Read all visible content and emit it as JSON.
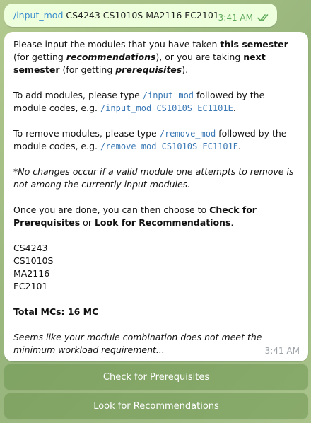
{
  "outgoing": {
    "command": "/input_mod",
    "modules_text": "CS4243 CS1010S MA2116 EC2101",
    "time": "3:41 AM",
    "status_icon": "double-check-icon"
  },
  "incoming": {
    "p1": {
      "a": "Please input the modules that you have taken ",
      "b": "this semester",
      "c": " (for getting ",
      "d": "recommendations",
      "e": "), or you are taking ",
      "f": "next semester",
      "g": " (for getting ",
      "h": "prerequisites",
      "i": ")."
    },
    "p2": {
      "a": "To add modules, please type ",
      "cmd": "/input_mod",
      "b": " followed by the module codes, e.g. ",
      "example": "/input_mod CS1010S EC1101E",
      "c": "."
    },
    "p3": {
      "a": "To remove modules, please type ",
      "cmd": "/remove_mod",
      "b": " followed by the module codes, e.g. ",
      "example": "/remove_mod CS1010S EC1101E",
      "c": "."
    },
    "note": "*No changes occur if a valid module one attempts to remove is not among the currently input modules.",
    "p4": {
      "a": "Once you are done, you can then choose to ",
      "b": "Check for Prerequisites",
      "c": " or ",
      "d": "Look for Recommendations",
      "e": "."
    },
    "modules": [
      "CS4243",
      "CS1010S",
      "MA2116",
      "EC2101"
    ],
    "total": "Total MCs: 16 MC",
    "warning": "Seems like your module combination does not meet the minimum workload requirement...",
    "time": "3:41 AM"
  },
  "keyboard": {
    "button1": "Check for Prerequisites",
    "button2": "Look for Recommendations"
  },
  "colors": {
    "outgoing_bubble": "#eeffde",
    "link": "#3a8dce",
    "check": "#5fa95b"
  }
}
